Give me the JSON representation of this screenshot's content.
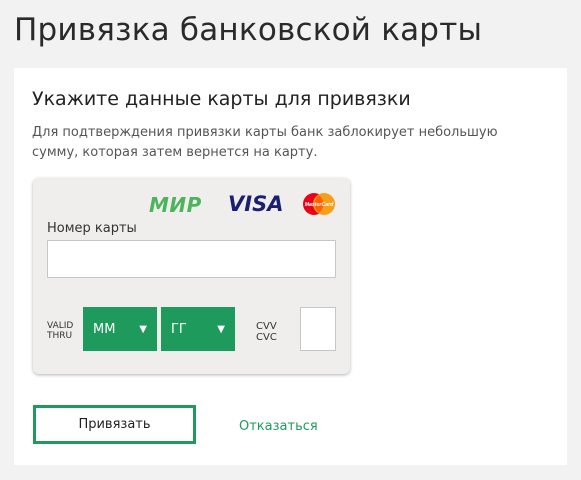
{
  "page": {
    "title": "Привязка банковской карты"
  },
  "panel": {
    "heading": "Укажите данные карты для привязки",
    "description": "Для подтверждения привязки карты банк заблокирует небольшую сумму, которая затем вернется на карту."
  },
  "card_form": {
    "logos": {
      "mir_icon": "mir-logo",
      "mir_text_main": "МИ",
      "mir_text_end": "Р",
      "visa_icon": "visa-logo",
      "visa_text": "VISA",
      "mastercard_icon": "mastercard-logo",
      "mastercard_text": "MasterCard"
    },
    "card_number_label": "Номер карты",
    "card_number_value": "",
    "valid_thru_line1": "VALID",
    "valid_thru_line2": "THRU",
    "month_select": {
      "selected": "ММ",
      "arrow_icon": "triangle-down-icon"
    },
    "year_select": {
      "selected": "ГГ",
      "arrow_icon": "triangle-down-icon"
    },
    "cvv_line1": "CVV",
    "cvv_line2": "CVC",
    "cvv_value": ""
  },
  "actions": {
    "bind_label": "Привязать",
    "cancel_label": "Отказаться"
  },
  "colors": {
    "accent_green": "#1e9a5c",
    "mir_green": "#4db45e",
    "visa_blue": "#1a1f71",
    "mastercard_red": "#eb001b",
    "mastercard_orange": "#f79e1b",
    "background": "#f2f2f2",
    "panel": "#ffffff",
    "card_form_bg": "#efeeec"
  }
}
